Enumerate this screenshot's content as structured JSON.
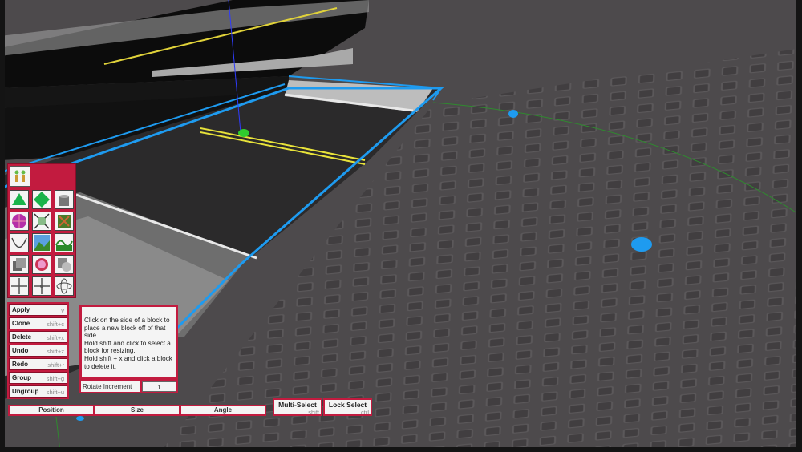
{
  "palette": {
    "tools": [
      {
        "name": "move-tool-icon"
      },
      {
        "name": "resize-tool-icon"
      },
      {
        "name": "paint-bucket-icon"
      },
      {
        "name": "material-sphere-icon"
      },
      {
        "name": "scale-arrows-icon"
      },
      {
        "name": "texture-tool-icon"
      },
      {
        "name": "curve-tool-icon"
      },
      {
        "name": "terrain-tool-icon"
      },
      {
        "name": "wave-tool-icon"
      },
      {
        "name": "block-tool-icon"
      },
      {
        "name": "mesh-tool-icon"
      },
      {
        "name": "union-tool-icon"
      },
      {
        "name": "grid-tool-icon"
      },
      {
        "name": "snap-tool-icon"
      },
      {
        "name": "rotate-axis-icon"
      }
    ]
  },
  "commands": [
    {
      "label": "Apply",
      "key": "v"
    },
    {
      "label": "Clone",
      "key": "shift+c"
    },
    {
      "label": "Delete",
      "key": "shift+x"
    },
    {
      "label": "Undo",
      "key": "shift+z"
    },
    {
      "label": "Redo",
      "key": "shift+r"
    },
    {
      "label": "Group",
      "key": "shift+g"
    },
    {
      "label": "Ungroup",
      "key": "shift+u"
    }
  ],
  "help": {
    "text": "Click on the side of a block to place a new block off of that side.\nHold shift and click to select a block for resizing.\nHold shift + x and click a block to delete it."
  },
  "rotate": {
    "label": "Rotate Increment",
    "value": "1"
  },
  "tabs": [
    {
      "label": "Position"
    },
    {
      "label": "Size"
    },
    {
      "label": "Angle"
    }
  ],
  "multi_select": {
    "label": "Multi-Select",
    "key": "shift"
  },
  "lock_select": {
    "label": "Lock Select",
    "key": "ctrl"
  },
  "colors": {
    "panel": "#c21b3f",
    "face": "#f4f4f4",
    "highlight": "#1e9bf0",
    "baseplate": "#4d4a4c"
  }
}
